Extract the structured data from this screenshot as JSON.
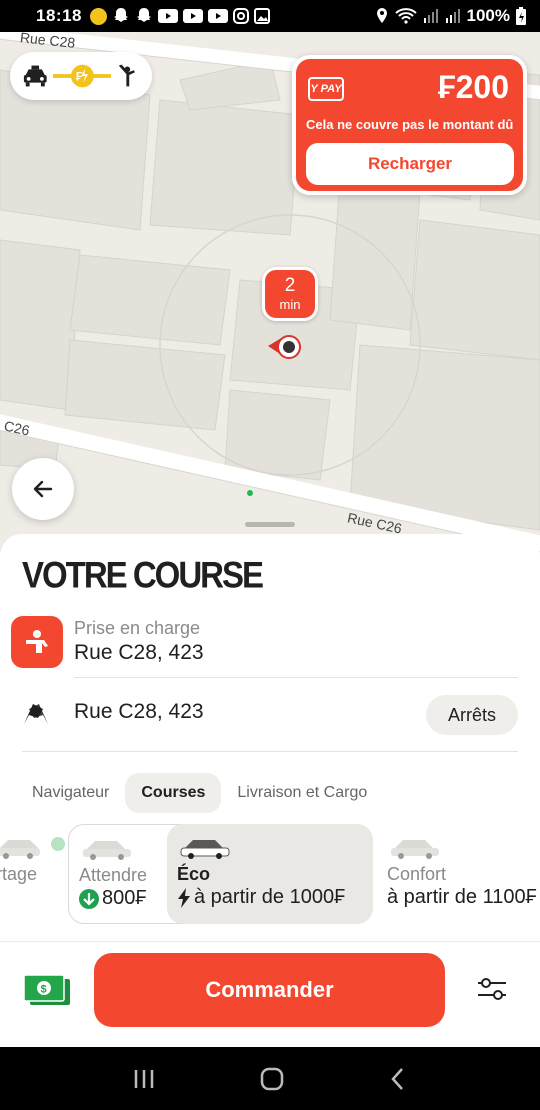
{
  "status": {
    "time": "18:18",
    "battery": "100%"
  },
  "map": {
    "road_labels": [
      "Rue C28",
      "C26",
      "Rue C26"
    ],
    "eta": {
      "value": "2",
      "unit": "min"
    }
  },
  "ypay": {
    "logo": "Y PAY",
    "amount": "₣200",
    "note": "Cela ne couvre pas le montant dû",
    "button": "Recharger"
  },
  "sheet": {
    "title": "VOTRE COURSE",
    "pickup": {
      "label": "Prise en charge",
      "address": "Rue C28, 423"
    },
    "destination": {
      "address": "Rue C28, 423"
    },
    "stops_button": "Arrêts",
    "tabs": [
      "Navigateur",
      "Courses",
      "Livraison et Cargo"
    ],
    "active_tab": "Courses",
    "tariffs": [
      {
        "name": "rtage",
        "price": ""
      },
      {
        "name": "Attendre",
        "price": "800₣"
      },
      {
        "name": "Éco",
        "price": "à partir de 1000₣",
        "selected": true
      },
      {
        "name": "Confort",
        "price": "à partir de 1100₣"
      }
    ]
  },
  "bottom": {
    "order_button": "Commander"
  },
  "colors": {
    "accent": "#f44730",
    "map_bg": "#efece6",
    "building": "#e3e0da"
  }
}
